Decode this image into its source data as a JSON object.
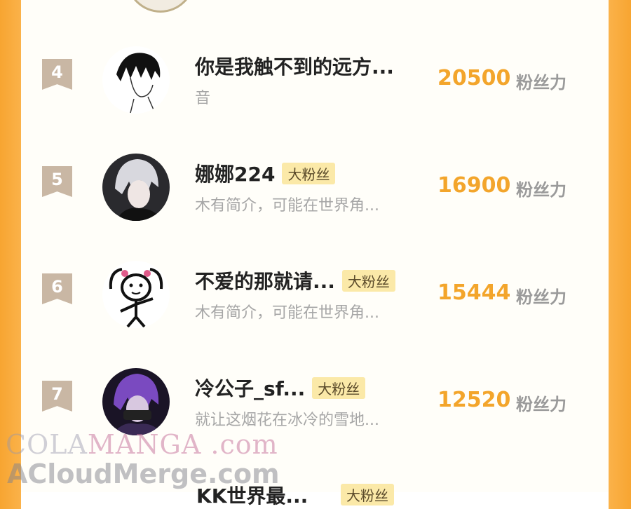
{
  "rows": [
    {
      "rank": "4",
      "name": "你是我触不到的远方...",
      "badge": "",
      "desc": "音",
      "score": "20500",
      "unit": "粉丝力",
      "avatar_icon": "sketch-boy-avatar"
    },
    {
      "rank": "5",
      "name": "娜娜224",
      "badge": "大粉丝",
      "desc": "木有简介，可能在世界角...",
      "score": "16900",
      "unit": "粉丝力",
      "avatar_icon": "white-hair-boy-avatar"
    },
    {
      "rank": "6",
      "name": "不爱的那就请...",
      "badge": "大粉丝",
      "desc": "木有简介，可能在世界角...",
      "score": "15444",
      "unit": "粉丝力",
      "avatar_icon": "stick-figure-avatar"
    },
    {
      "rank": "7",
      "name": "冷公子_sf...",
      "badge": "大粉丝",
      "desc": "就让这烟花在冰冷的雪地...",
      "score": "12520",
      "unit": "粉丝力",
      "avatar_icon": "purple-hair-boy-avatar"
    }
  ],
  "partial_row": {
    "name": "KK世界最...",
    "badge": "大粉丝"
  },
  "watermark": {
    "line1_a": "COLA",
    "line1_b": "MANGA",
    "line1_c": " .com",
    "line2": "ACloudMerge.com"
  },
  "colors": {
    "accent_orange": "#f3a52b",
    "side_orange": "#f7a531",
    "badge_bg": "#fbe9a8",
    "rank_bg": "#c9b7a4"
  }
}
